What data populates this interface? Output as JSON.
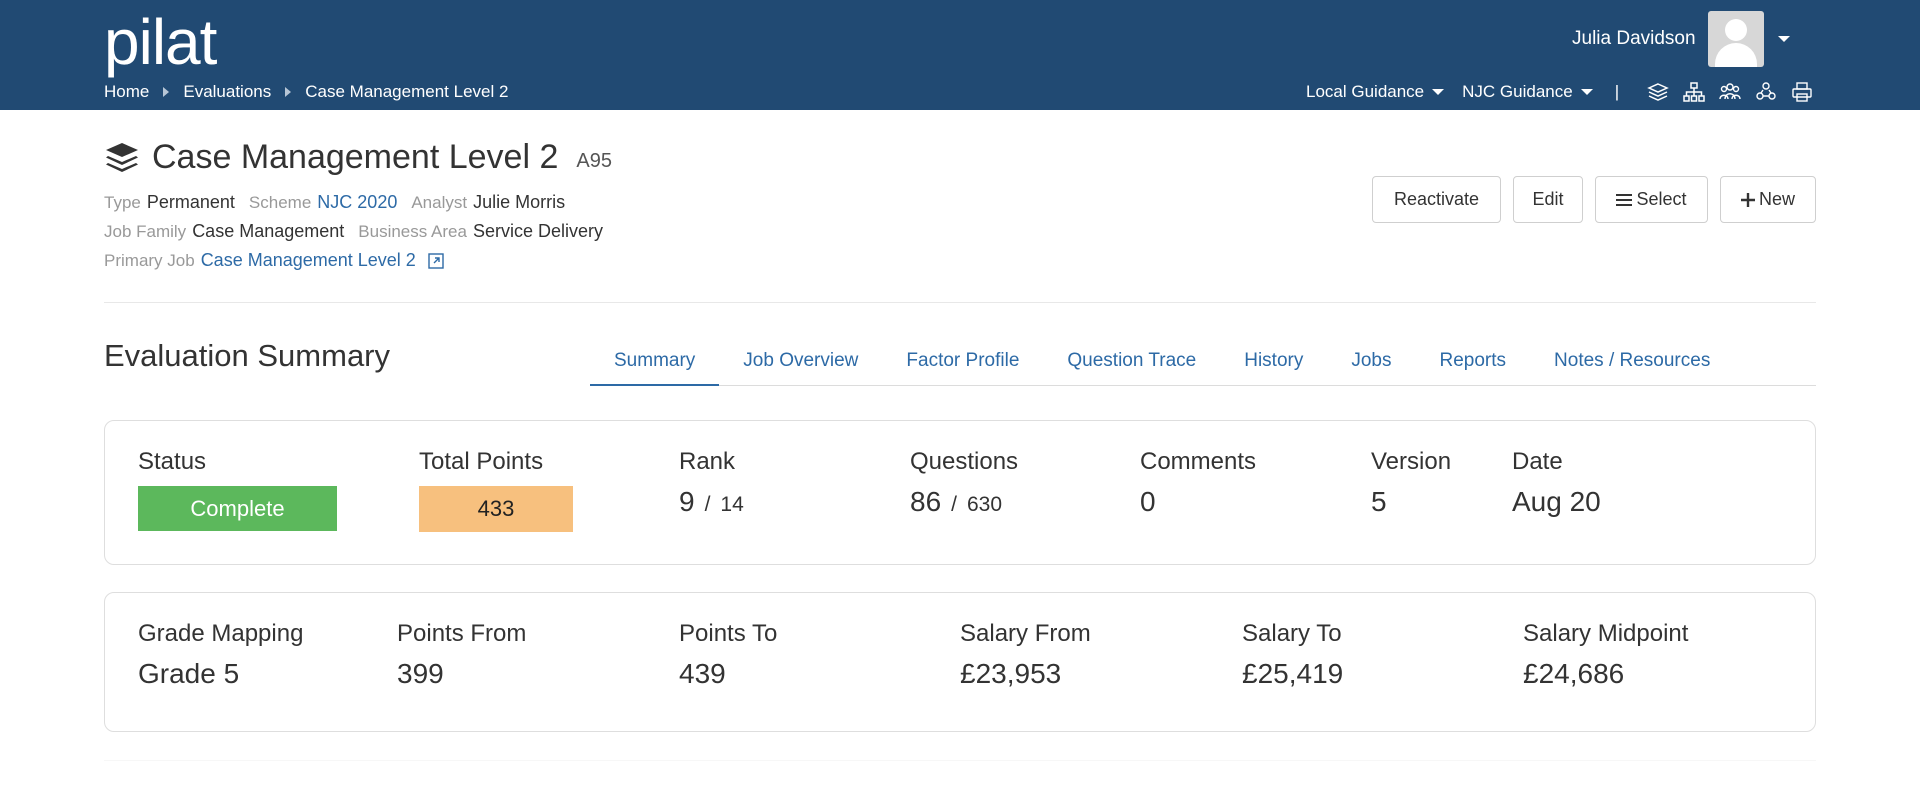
{
  "header": {
    "logo": "pilat",
    "breadcrumb": [
      "Home",
      "Evaluations",
      "Case Management Level 2"
    ],
    "user_name": "Julia Davidson",
    "local_guidance": "Local Guidance",
    "njc_guidance": "NJC Guidance",
    "pipe": "|",
    "icons": [
      "layers-icon",
      "org-chart-icon",
      "people-icon",
      "group-icon",
      "print-icon"
    ]
  },
  "job": {
    "title": "Case Management Level 2",
    "code": "A95",
    "type_label": "Type",
    "type": "Permanent",
    "scheme_label": "Scheme",
    "scheme": "NJC 2020",
    "analyst_label": "Analyst",
    "analyst": "Julie Morris",
    "family_label": "Job Family",
    "family": "Case Management",
    "area_label": "Business Area",
    "area": "Service Delivery",
    "primary_label": "Primary Job",
    "primary": "Case Management Level 2"
  },
  "actions": {
    "reactivate": "Reactivate",
    "edit": "Edit",
    "select": "Select",
    "new": "New"
  },
  "section_title": "Evaluation Summary",
  "tabs": [
    "Summary",
    "Job Overview",
    "Factor Profile",
    "Question Trace",
    "History",
    "Jobs",
    "Reports",
    "Notes / Resources"
  ],
  "summary": {
    "status_label": "Status",
    "status": "Complete",
    "points_label": "Total Points",
    "points": "433",
    "rank_label": "Rank",
    "rank": "9",
    "rank_of": "14",
    "questions_label": "Questions",
    "questions": "86",
    "questions_of": "630",
    "comments_label": "Comments",
    "comments": "0",
    "version_label": "Version",
    "version": "5",
    "date_label": "Date",
    "date": "Aug 20",
    "slash": "/"
  },
  "grade": {
    "mapping_label": "Grade Mapping",
    "mapping": "Grade 5",
    "from_label": "Points From",
    "from": "399",
    "to_label": "Points To",
    "to": "439",
    "sal_from_label": "Salary From",
    "sal_from": "£23,953",
    "sal_to_label": "Salary To",
    "sal_to": "£25,419",
    "mid_label": "Salary Midpoint",
    "mid": "£24,686"
  },
  "colors": {
    "header_bg": "#214a73",
    "link": "#2d6aa6",
    "status_green": "#5cb85c",
    "points_orange": "#f7c07e"
  }
}
